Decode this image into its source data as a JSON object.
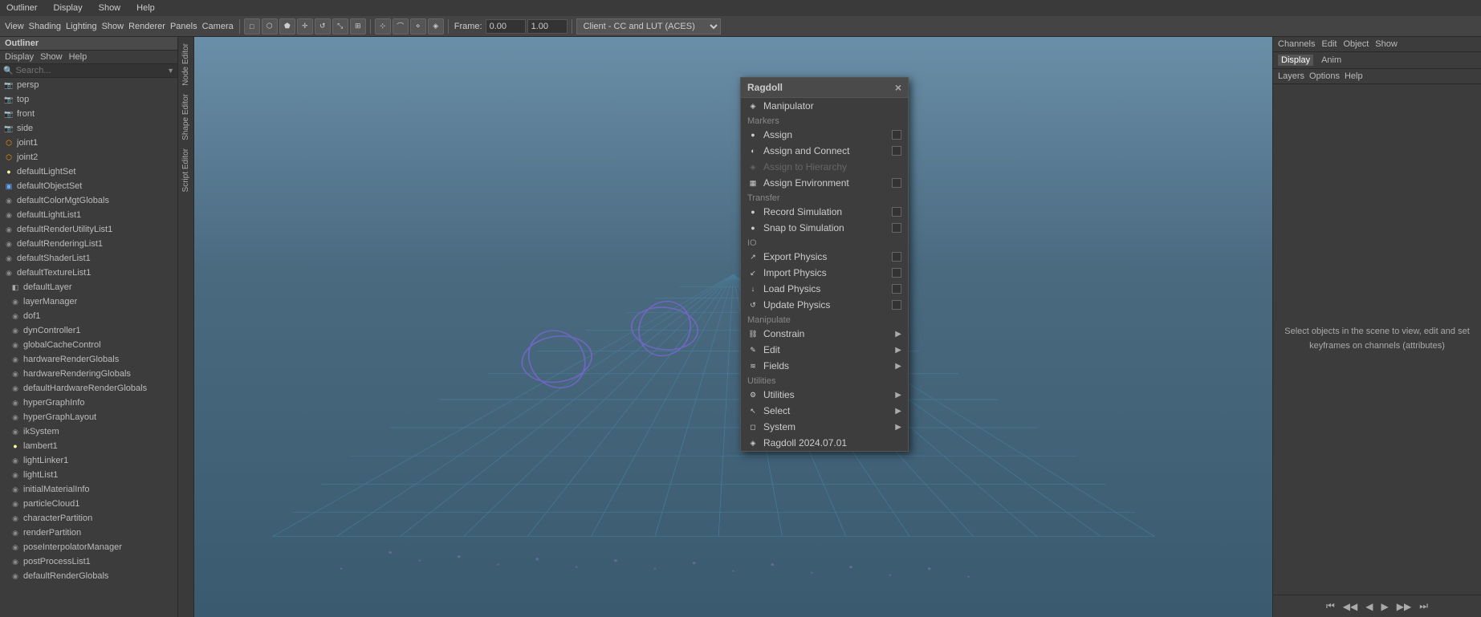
{
  "app": {
    "title": "Outliner"
  },
  "topmenu": {
    "items": [
      "Display",
      "Show",
      "Help"
    ]
  },
  "viewport_topmenu": {
    "items": [
      "View",
      "Shading",
      "Lighting",
      "Show",
      "Renderer",
      "Panels",
      "Camera"
    ]
  },
  "toolbar": {
    "frame_value": "0.00",
    "step_value": "1.00",
    "renderer": "Client - CC and LUT (ACES)"
  },
  "search": {
    "placeholder": "Search..."
  },
  "outliner": {
    "items": [
      {
        "label": "persp",
        "icon": "camera"
      },
      {
        "label": "top",
        "icon": "camera"
      },
      {
        "label": "front",
        "icon": "camera"
      },
      {
        "label": "side",
        "icon": "camera"
      },
      {
        "label": "joint1",
        "icon": "joint"
      },
      {
        "label": "joint2",
        "icon": "joint"
      },
      {
        "label": "defaultLightSet",
        "icon": "light"
      },
      {
        "label": "defaultObjectSet",
        "icon": "mesh"
      },
      {
        "label": "defaultColorMgtGlobals",
        "icon": "default"
      },
      {
        "label": "defaultLightList1",
        "icon": "default"
      },
      {
        "label": "defaultRenderUtilityList1",
        "icon": "default"
      },
      {
        "label": "defaultRenderingList1",
        "icon": "default"
      },
      {
        "label": "defaultShaderList1",
        "icon": "default"
      },
      {
        "label": "defaultTextureList1",
        "icon": "default"
      },
      {
        "label": "defaultLayer",
        "icon": "layer",
        "indent": true
      },
      {
        "label": "layerManager",
        "icon": "default",
        "indent": true
      },
      {
        "label": "dof1",
        "icon": "default",
        "indent": true
      },
      {
        "label": "dynController1",
        "icon": "default",
        "indent": true
      },
      {
        "label": "globalCacheControl",
        "icon": "default",
        "indent": true
      },
      {
        "label": "hardwareRenderGlobals",
        "icon": "default",
        "indent": true
      },
      {
        "label": "hardwareRenderingGlobals",
        "icon": "default",
        "indent": true
      },
      {
        "label": "defaultHardwareRenderGlobals",
        "icon": "default",
        "indent": true
      },
      {
        "label": "hyperGraphInfo",
        "icon": "default",
        "indent": true
      },
      {
        "label": "hyperGraphLayout",
        "icon": "default",
        "indent": true
      },
      {
        "label": "ikSystem",
        "icon": "default",
        "indent": true
      },
      {
        "label": "lambert1",
        "icon": "light",
        "indent": true
      },
      {
        "label": "lightLinker1",
        "icon": "default",
        "indent": true
      },
      {
        "label": "lightList1",
        "icon": "default",
        "indent": true
      },
      {
        "label": "initialMaterialInfo",
        "icon": "default",
        "indent": true
      },
      {
        "label": "particleCloud1",
        "icon": "default",
        "indent": true
      },
      {
        "label": "characterPartition",
        "icon": "default",
        "indent": true
      },
      {
        "label": "renderPartition",
        "icon": "default",
        "indent": true
      },
      {
        "label": "poseInterpolatorManager",
        "icon": "default",
        "indent": true
      },
      {
        "label": "postProcessList1",
        "icon": "default",
        "indent": true
      },
      {
        "label": "defaultRenderGlobals",
        "icon": "default",
        "indent": true
      }
    ]
  },
  "side_tabs": [
    "Node Editor",
    "Shape Editor",
    "Script Editor"
  ],
  "ragdoll": {
    "title": "Ragdoll",
    "close_label": "×",
    "sections": [
      {
        "label": "",
        "items": [
          {
            "label": "Manipulator",
            "icon": "◈",
            "type": "item",
            "has_arrow": false,
            "has_checkbox": false
          }
        ]
      },
      {
        "label": "Markers",
        "items": [
          {
            "label": "Assign",
            "icon": "●",
            "type": "item",
            "has_arrow": false,
            "has_checkbox": true
          },
          {
            "label": "Assign and Connect",
            "icon": "◐",
            "type": "item",
            "has_arrow": false,
            "has_checkbox": true
          },
          {
            "label": "Assign to Hierarchy",
            "icon": "◈",
            "type": "item",
            "has_arrow": false,
            "has_checkbox": false,
            "disabled": true
          },
          {
            "label": "Assign Environment",
            "icon": "▦",
            "type": "item",
            "has_arrow": false,
            "has_checkbox": true
          }
        ]
      },
      {
        "label": "Transfer",
        "items": [
          {
            "label": "Record Simulation",
            "icon": "●",
            "type": "item",
            "has_arrow": false,
            "has_checkbox": true
          },
          {
            "label": "Snap to Simulation",
            "icon": "●",
            "type": "item",
            "has_arrow": false,
            "has_checkbox": true
          }
        ]
      },
      {
        "label": "IO",
        "items": [
          {
            "label": "Export Physics",
            "icon": "↗",
            "type": "item",
            "has_arrow": false,
            "has_checkbox": true
          },
          {
            "label": "Import Physics",
            "icon": "↙",
            "type": "item",
            "has_arrow": false,
            "has_checkbox": true
          },
          {
            "label": "Load Physics",
            "icon": "↓",
            "type": "item",
            "has_arrow": false,
            "has_checkbox": true
          },
          {
            "label": "Update Physics",
            "icon": "↺",
            "type": "item",
            "has_arrow": false,
            "has_checkbox": true
          }
        ]
      },
      {
        "label": "Manipulate",
        "items": [
          {
            "label": "Constrain",
            "icon": "⛓",
            "type": "item",
            "has_arrow": true,
            "has_checkbox": false
          },
          {
            "label": "Edit",
            "icon": "✎",
            "type": "item",
            "has_arrow": true,
            "has_checkbox": false
          },
          {
            "label": "Fields",
            "icon": "≋",
            "type": "item",
            "has_arrow": true,
            "has_checkbox": false
          }
        ]
      },
      {
        "label": "Utilities",
        "items": [
          {
            "label": "Utilities",
            "icon": "⚙",
            "type": "item",
            "has_arrow": true,
            "has_checkbox": false
          },
          {
            "label": "Select",
            "icon": "↖",
            "type": "item",
            "has_arrow": true,
            "has_checkbox": false
          },
          {
            "label": "System",
            "icon": "◻",
            "type": "item",
            "has_arrow": true,
            "has_checkbox": false
          }
        ]
      },
      {
        "label": "",
        "items": [
          {
            "label": "Ragdoll 2024.07.01",
            "icon": "◈",
            "type": "item",
            "has_arrow": false,
            "has_checkbox": false
          }
        ]
      }
    ]
  },
  "right_panel": {
    "top_menu": [
      "Channels",
      "Edit",
      "Object",
      "Show"
    ],
    "tabs": [
      "Display",
      "Anim"
    ],
    "sub_tabs": [
      "Layers",
      "Options",
      "Help"
    ],
    "content_text": "Select objects in the scene to view, edit and set keyframes on channels (attributes)",
    "timeline_buttons": [
      "⏮",
      "◀◀",
      "◀",
      "▶",
      "▶▶",
      "⏭"
    ]
  }
}
